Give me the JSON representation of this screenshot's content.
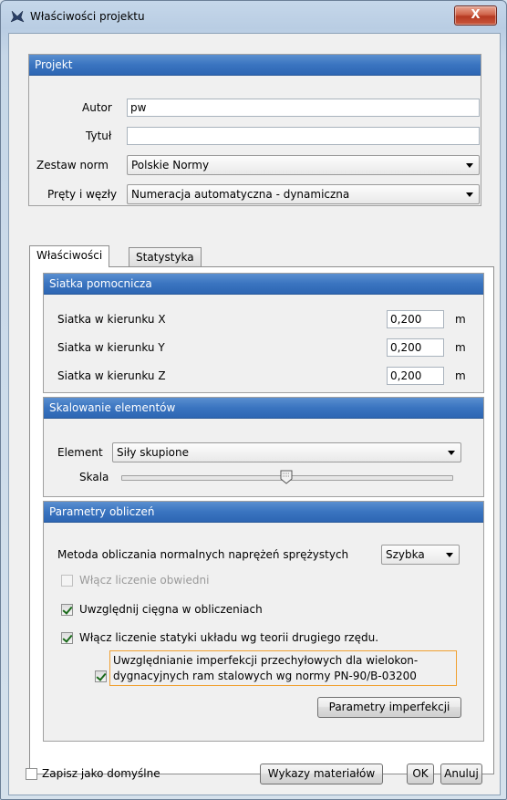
{
  "window": {
    "title": "Właściwości projektu",
    "close_glyph": "X"
  },
  "projekt": {
    "header": "Projekt",
    "autor_label": "Autor",
    "autor_value": "pw",
    "tytul_label": "Tytuł",
    "tytul_value": "",
    "zestaw_label": "Zestaw norm",
    "zestaw_value": "Polskie Normy",
    "prety_label": "Pręty i węzły",
    "prety_value": "Numeracja automatyczna - dynamiczna"
  },
  "tabs": [
    {
      "label": "Właściwości",
      "active": true
    },
    {
      "label": "Statystyka",
      "active": false
    }
  ],
  "siatka": {
    "header": "Siatka pomocnicza",
    "rows": [
      {
        "label": "Siatka w kierunku X",
        "value": "0,200",
        "unit": "m"
      },
      {
        "label": "Siatka w kierunku Y",
        "value": "0,200",
        "unit": "m"
      },
      {
        "label": "Siatka w kierunku Z",
        "value": "0,200",
        "unit": "m"
      }
    ]
  },
  "skalowanie": {
    "header": "Skalowanie elementów",
    "element_label": "Element",
    "element_value": "Siły skupione",
    "skala_label": "Skala",
    "skala_level": 0.5
  },
  "parametry": {
    "header": "Parametry obliczeń",
    "metoda_label": "Metoda obliczania normalnych naprężeń sprężystych",
    "metoda_value": "Szybka",
    "cb1": {
      "label": "Włącz liczenie obwiedni",
      "checked": false,
      "enabled": false
    },
    "cb2": {
      "label": "Uwzględnij cięgna w obliczeniach",
      "checked": true,
      "enabled": true
    },
    "cb3": {
      "label": "Włącz liczenie statyki układu wg teorii drugiego rzędu.",
      "checked": true,
      "enabled": true
    },
    "cb4": {
      "line1": "Uwzględnianie imperfekcji przechyłowych dla wielokon-",
      "line2": "dygnacyjnych ram stalowych wg normy PN-90/B-03200",
      "checked": true
    },
    "imperfekcji_button": "Parametry imperfekcji"
  },
  "footer": {
    "zapisz_label": "Zapisz jako domyślne",
    "wykazy_button": "Wykazy materiałów",
    "ok_button": "OK",
    "anuluj_button": "Anuluj"
  },
  "colors": {
    "panel_header": "#3a74c0",
    "focus_outline": "#f0a030",
    "close_button": "#c9573c"
  }
}
